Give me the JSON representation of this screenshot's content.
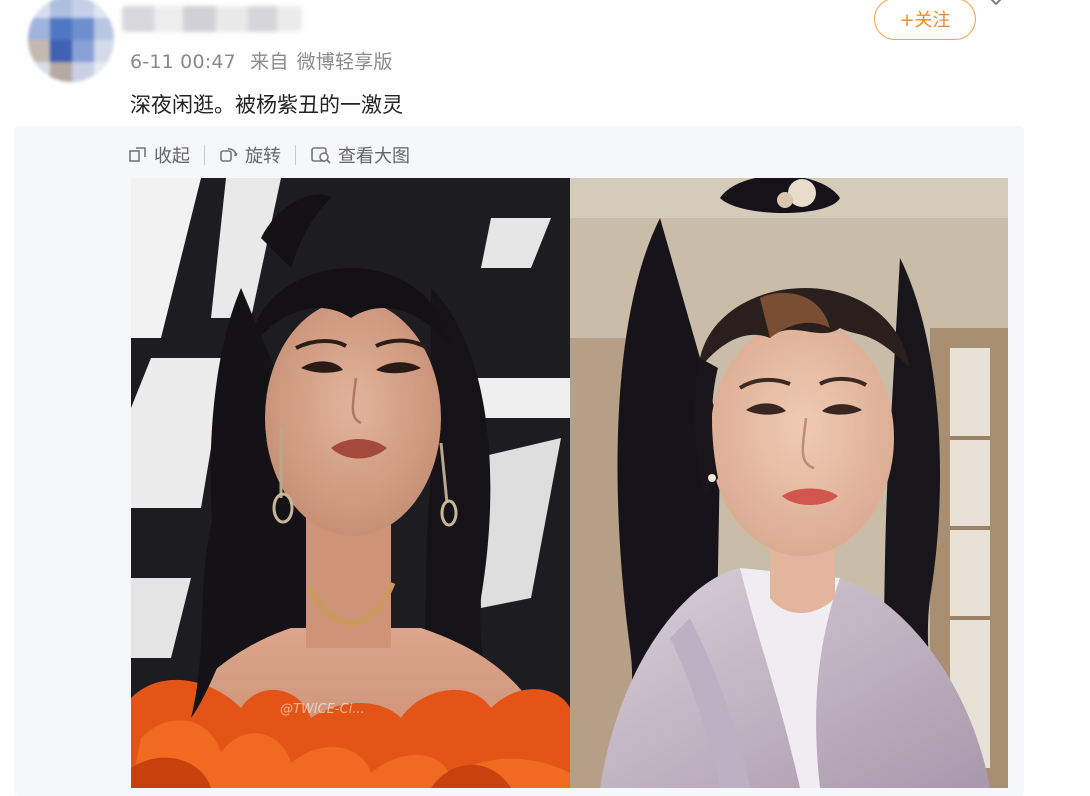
{
  "post": {
    "time": "6-11 00:47",
    "from_label": "来自",
    "source": "微博轻享版",
    "follow_label": "+关注",
    "text": "深夜闲逛。被杨紫丑的一激灵"
  },
  "toolbar": {
    "collect_label": "收起",
    "rotate_label": "旋转",
    "view_large_label": "查看大图"
  },
  "images": [
    {
      "name": "left-photo",
      "watermark": "@TWICE-Ci..."
    },
    {
      "name": "right-photo"
    }
  ],
  "colors": {
    "follow_accent": "#f08a24",
    "meta_text": "#8a8a8a",
    "card_bg": "#f6f7f9"
  },
  "icons": [
    "collapse-icon",
    "rotate-icon",
    "view-large-icon",
    "more-icon"
  ]
}
